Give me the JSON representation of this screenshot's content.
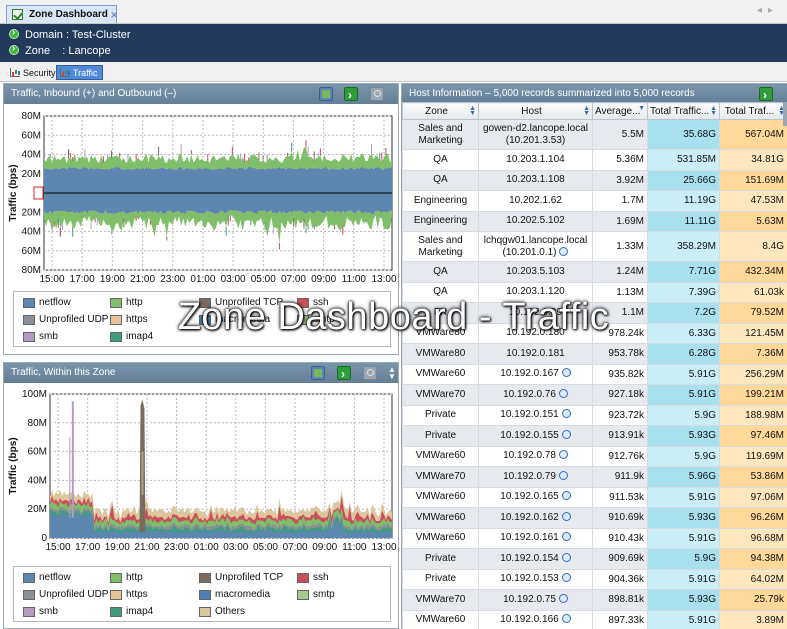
{
  "tab": {
    "title": "Zone Dashboard"
  },
  "info": {
    "domain": "Domain : Test-Cluster",
    "zone": "Zone    : Lancope"
  },
  "subtabs": [
    {
      "label": "Security",
      "active": false
    },
    {
      "label": "Traffic",
      "active": true
    }
  ],
  "overlay_title": "Zone Dashboard - Traffic",
  "colors": {
    "netflow": "#5b87b0",
    "http": "#7fbf6a",
    "unprofiled_tcp": "#7a6b5e",
    "ssh": "#c9505a",
    "unprofiled_udp": "#8a9097",
    "https": "#e8c39a",
    "macromedia": "#4f7fb8",
    "smtp": "#a3c98b",
    "smb": "#b49bc4",
    "imap4": "#3f9c7e",
    "others": "#d8c8a0"
  },
  "panel1": {
    "title": "Traffic, Inbound (+) and Outbound (–)",
    "chart_data": {
      "type": "area",
      "ylabel": "Traffic (bps)",
      "y_ticks": [
        "80M",
        "60M",
        "40M",
        "20M",
        "0",
        "20M",
        "40M",
        "60M",
        "80M"
      ],
      "ylim": [
        -80000000,
        80000000
      ],
      "x_ticks": [
        "15:00",
        "17:00",
        "19:00",
        "21:00",
        "23:00",
        "01:00",
        "03:00",
        "05:00",
        "07:00",
        "09:00",
        "11:00",
        "13:00"
      ],
      "grid": true,
      "series": [
        {
          "name": "netflow",
          "inbound_approx": 25000000,
          "outbound_approx": -20000000
        },
        {
          "name": "http",
          "inbound_approx": 8000000,
          "outbound_approx": -12000000
        }
      ]
    },
    "legend": [
      {
        "key": "netflow",
        "label": "netflow"
      },
      {
        "key": "http",
        "label": "http"
      },
      {
        "key": "unprofiled_tcp",
        "label": "Unprofiled TCP"
      },
      {
        "key": "ssh",
        "label": "ssh"
      },
      {
        "key": "unprofiled_udp",
        "label": "Unprofiled UDP"
      },
      {
        "key": "https",
        "label": "https"
      },
      {
        "key": "macromedia",
        "label": "macromedia"
      },
      {
        "key": "smtp",
        "label": "smtp"
      },
      {
        "key": "smb",
        "label": "smb"
      },
      {
        "key": "imap4",
        "label": "imap4"
      }
    ]
  },
  "panel2": {
    "title": "Traffic, Within this Zone",
    "chart_data": {
      "type": "area",
      "ylabel": "Traffic (bps)",
      "y_ticks": [
        "100M",
        "80M",
        "60M",
        "40M",
        "20M",
        "0"
      ],
      "ylim": [
        0,
        100000000
      ],
      "x_ticks": [
        "15:00",
        "17:00",
        "19:00",
        "21:00",
        "23:00",
        "01:00",
        "03:00",
        "05:00",
        "07:00",
        "09:00",
        "11:00",
        "13:00"
      ],
      "grid": true,
      "peaks": [
        {
          "x": "16:00",
          "value": 95000000,
          "series": "smb"
        },
        {
          "x": "20:30",
          "value": 95000000,
          "series": "unprofiled_tcp"
        }
      ]
    },
    "legend": [
      {
        "key": "netflow",
        "label": "netflow"
      },
      {
        "key": "http",
        "label": "http"
      },
      {
        "key": "unprofiled_tcp",
        "label": "Unprofiled TCP"
      },
      {
        "key": "ssh",
        "label": "ssh"
      },
      {
        "key": "unprofiled_udp",
        "label": "Unprofiled UDP"
      },
      {
        "key": "https",
        "label": "https"
      },
      {
        "key": "macromedia",
        "label": "macromedia"
      },
      {
        "key": "smtp",
        "label": "smtp"
      },
      {
        "key": "smb",
        "label": "smb"
      },
      {
        "key": "imap4",
        "label": "imap4"
      },
      {
        "key": "others",
        "label": "Others"
      }
    ]
  },
  "hosts": {
    "title": "Host Information – 5,000 records summarized into 5,000 records",
    "columns": [
      "Zone",
      "Host",
      "Average...",
      "Total Traffic...",
      "Total Traf..."
    ],
    "rows": [
      {
        "zone": "Sales and Marketing",
        "host": "gowen-d2.lancope.local",
        "ip": "(10.201.3.53)",
        "info": false,
        "avg": "5.5M",
        "tt": "35.68G",
        "t2": "567.04M"
      },
      {
        "zone": "QA",
        "host": "10.203.1.104",
        "ip": "",
        "info": false,
        "avg": "5.36M",
        "tt": "531.85M",
        "t2": "34.81G"
      },
      {
        "zone": "QA",
        "host": "10.203.1.108",
        "ip": "",
        "info": false,
        "avg": "3.92M",
        "tt": "25.66G",
        "t2": "151.69M"
      },
      {
        "zone": "Engineering",
        "host": "10.202.1.62",
        "ip": "",
        "info": false,
        "avg": "1.7M",
        "tt": "11.19G",
        "t2": "47.53M"
      },
      {
        "zone": "Engineering",
        "host": "10.202.5.102",
        "ip": "",
        "info": false,
        "avg": "1.69M",
        "tt": "11.11G",
        "t2": "5.63M"
      },
      {
        "zone": "Sales and Marketing",
        "host": "lchqgw01.lancope.local",
        "ip": "(10.201.0.1)",
        "info": true,
        "avg": "1.33M",
        "tt": "358.29M",
        "t2": "8.4G"
      },
      {
        "zone": "QA",
        "host": "10.203.5.103",
        "ip": "",
        "info": false,
        "avg": "1.24M",
        "tt": "7.71G",
        "t2": "432.34M"
      },
      {
        "zone": "QA",
        "host": "10.203.1.120",
        "ip": "",
        "info": false,
        "avg": "1.13M",
        "tt": "7.39G",
        "t2": "61.03k"
      },
      {
        "zone": "FR",
        "host": "10.192.0.39",
        "ip": "",
        "info": false,
        "avg": "1.1M",
        "tt": "7.2G",
        "t2": "79.52M"
      },
      {
        "zone": "VMWare80",
        "host": "10.192.0.180",
        "ip": "",
        "info": false,
        "avg": "978.24k",
        "tt": "6.33G",
        "t2": "121.45M"
      },
      {
        "zone": "VMWare80",
        "host": "10.192.0.181",
        "ip": "",
        "info": false,
        "avg": "953.78k",
        "tt": "6.28G",
        "t2": "7.36M"
      },
      {
        "zone": "VMWare60",
        "host": "10.192.0.167",
        "ip": "",
        "info": true,
        "avg": "935.82k",
        "tt": "5.91G",
        "t2": "256.29M"
      },
      {
        "zone": "VMWare70",
        "host": "10.192.0.76",
        "ip": "",
        "info": true,
        "avg": "927.18k",
        "tt": "5.91G",
        "t2": "199.21M"
      },
      {
        "zone": "Private",
        "host": "10.192.0.151",
        "ip": "",
        "info": true,
        "avg": "923.72k",
        "tt": "5.9G",
        "t2": "188.98M"
      },
      {
        "zone": "Private",
        "host": "10.192.0.155",
        "ip": "",
        "info": true,
        "avg": "913.91k",
        "tt": "5.93G",
        "t2": "97.46M"
      },
      {
        "zone": "VMWare60",
        "host": "10.192.0.78",
        "ip": "",
        "info": true,
        "avg": "912.76k",
        "tt": "5.9G",
        "t2": "119.69M"
      },
      {
        "zone": "VMWare70",
        "host": "10.192.0.79",
        "ip": "",
        "info": true,
        "avg": "911.9k",
        "tt": "5.96G",
        "t2": "53.86M"
      },
      {
        "zone": "VMWare60",
        "host": "10.192.0.165",
        "ip": "",
        "info": true,
        "avg": "911.53k",
        "tt": "5.91G",
        "t2": "97.06M"
      },
      {
        "zone": "VMWare60",
        "host": "10.192.0.162",
        "ip": "",
        "info": true,
        "avg": "910.69k",
        "tt": "5.93G",
        "t2": "96.26M"
      },
      {
        "zone": "VMWare60",
        "host": "10.192.0.161",
        "ip": "",
        "info": true,
        "avg": "910.43k",
        "tt": "5.91G",
        "t2": "96.68M"
      },
      {
        "zone": "Private",
        "host": "10.192.0.154",
        "ip": "",
        "info": true,
        "avg": "909.69k",
        "tt": "5.9G",
        "t2": "94.38M"
      },
      {
        "zone": "Private",
        "host": "10.192.0.153",
        "ip": "",
        "info": true,
        "avg": "904.36k",
        "tt": "5.91G",
        "t2": "64.02M"
      },
      {
        "zone": "VMWare70",
        "host": "10.192.0.75",
        "ip": "",
        "info": true,
        "avg": "898.81k",
        "tt": "5.93G",
        "t2": "25.79k"
      },
      {
        "zone": "VMWare60",
        "host": "10.192.0.166",
        "ip": "",
        "info": true,
        "avg": "897.33k",
        "tt": "5.91G",
        "t2": "3.89M"
      }
    ]
  }
}
